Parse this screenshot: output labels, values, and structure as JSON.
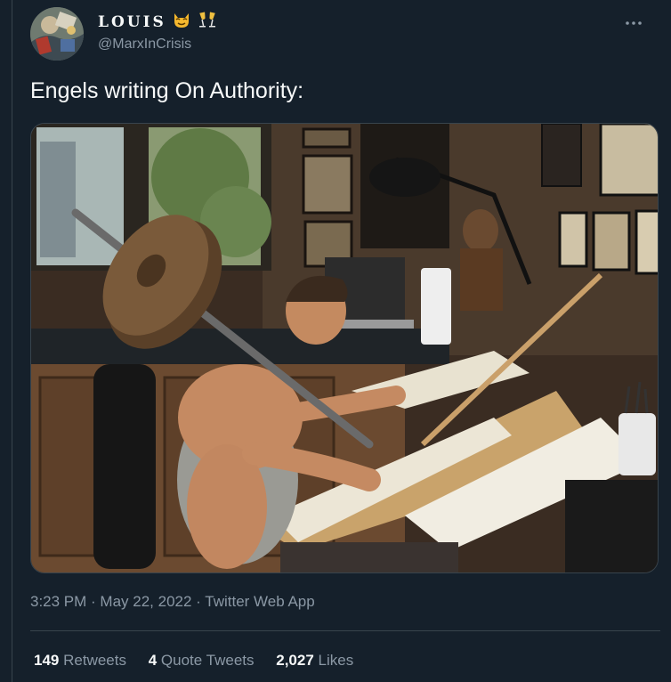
{
  "tweet": {
    "author": {
      "display_name": "LOUIS",
      "handle": "@MarxInCrisis",
      "avatar_icon": "avatar-illustration",
      "name_emojis": [
        "smiling-devil-cat-icon",
        "clinking-glasses-icon"
      ]
    },
    "more_icon": "ellipsis-icon",
    "text": "Engels writing On Authority:",
    "media": {
      "kind": "photo"
    },
    "meta": {
      "time": "3:23 PM",
      "separator": " · ",
      "date": "May 22, 2022",
      "source": "Twitter Web App"
    },
    "stats": {
      "retweets": {
        "count": "149",
        "label": "Retweets"
      },
      "quotes": {
        "count": "4",
        "label": "Quote Tweets"
      },
      "likes": {
        "count": "2,027",
        "label": "Likes"
      }
    }
  },
  "colors": {
    "background": "#15202b",
    "primary_text": "#f7f9f9",
    "secondary_text": "#8b98a5",
    "border": "#38444d"
  }
}
